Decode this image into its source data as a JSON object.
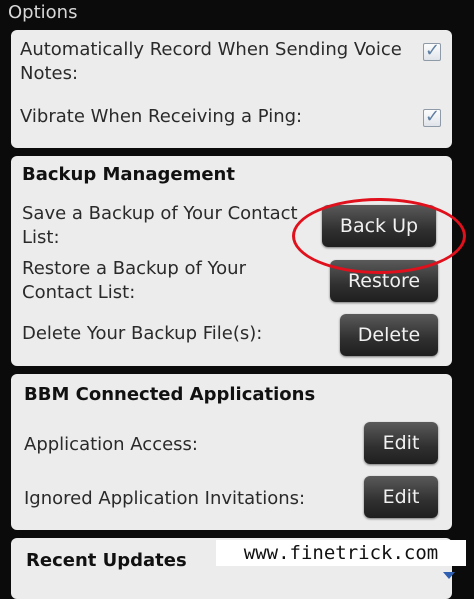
{
  "screen": {
    "title": "Options"
  },
  "general": {
    "auto_record_label": "Automatically Record When Sending Voice Notes:",
    "vibrate_label": "Vibrate When Receiving a Ping:"
  },
  "backup": {
    "heading": "Backup Management",
    "save_label": "Save a Backup of Your Contact List:",
    "save_button": "Back Up",
    "restore_label": "Restore a Backup of Your Contact List:",
    "restore_button": "Restore",
    "delete_label": "Delete Your Backup File(s):",
    "delete_button": "Delete"
  },
  "connected": {
    "heading": "BBM Connected Applications",
    "access_label": "Application Access:",
    "access_button": "Edit",
    "ignored_label": "Ignored Application Invitations:",
    "ignored_button": "Edit"
  },
  "recent": {
    "heading": "Recent Updates"
  },
  "watermark": {
    "text": "www.finetrick.com"
  }
}
